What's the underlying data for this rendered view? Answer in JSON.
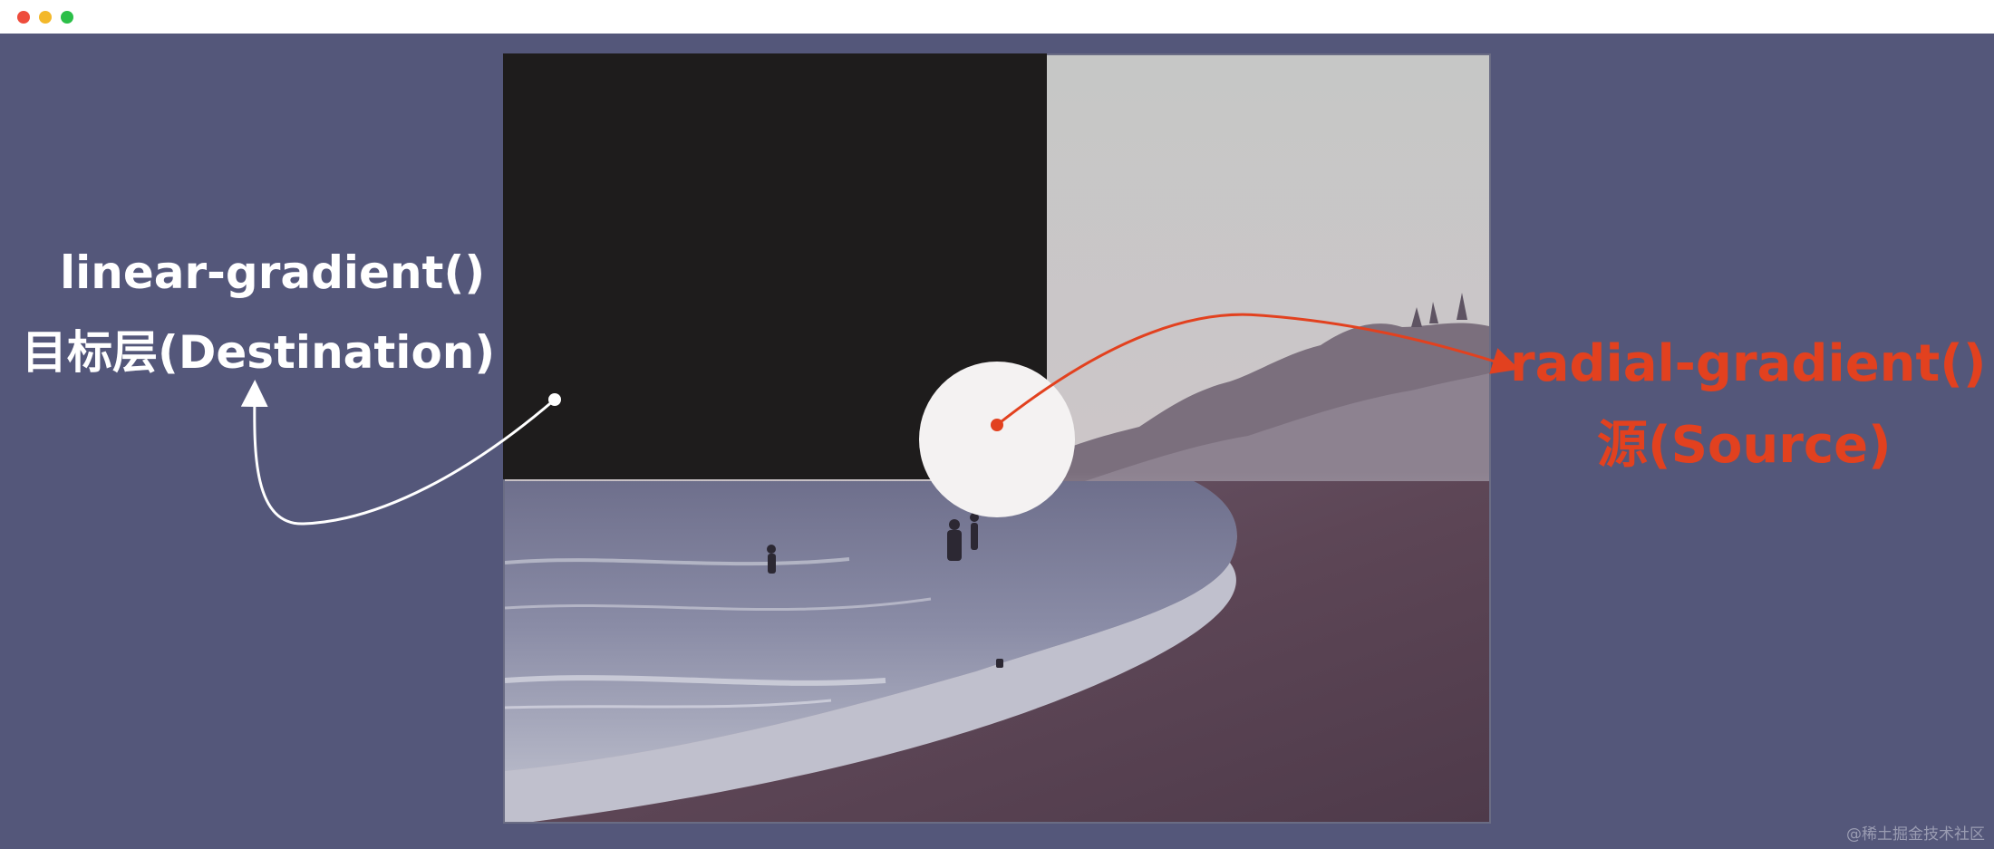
{
  "window": {
    "traffic_lights": {
      "close_color": "#ee4c3c",
      "minimize_color": "#f3b82a",
      "maximize_color": "#2bbf48"
    }
  },
  "background_color": "#54577a",
  "destination": {
    "function_label": "linear-gradient()",
    "layer_label": "目标层(Destination)",
    "color": "#ffffff",
    "layer_fill": "#1e1c1c"
  },
  "source": {
    "function_label": "radial-gradient()",
    "layer_label": "源(Source)",
    "color": "#e2411f",
    "circle_fill": "#f4f2f2"
  },
  "photo": {
    "icon": "beach-photo"
  },
  "watermark": "@稀土掘金技术社区"
}
